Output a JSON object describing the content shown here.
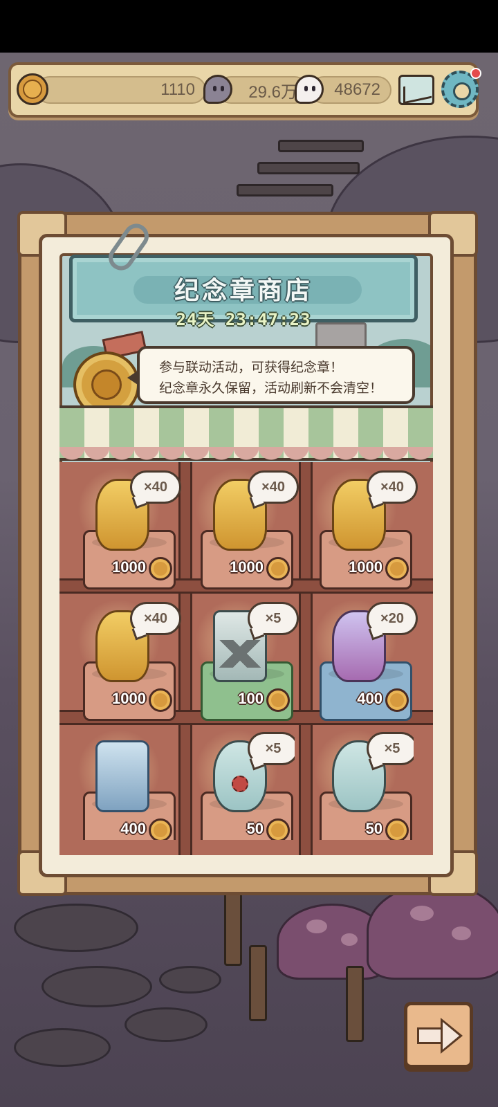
{
  "status_bar": {},
  "top_bar": {
    "coins": "1110",
    "gray_bubbles": "29.6万",
    "white_bubbles": "48672",
    "icons": [
      "coin-icon",
      "gray-bubble-icon",
      "white-bubble-icon",
      "mail-icon",
      "gear-icon"
    ],
    "settings_has_notification": true
  },
  "shop": {
    "title": "纪念章商店",
    "timer": "24天 23:47:23",
    "tip_line1": "参与联动活动，可获得纪念章！",
    "tip_line2": "纪念章永久保留，活动刷新不会清空！",
    "items": [
      {
        "quantity": "×40",
        "price": "1000",
        "figure": "golden-monkey-statue",
        "stand": "red"
      },
      {
        "quantity": "×40",
        "price": "1000",
        "figure": "golden-winged-creature-statue",
        "stand": "red"
      },
      {
        "quantity": "×40",
        "price": "1000",
        "figure": "golden-bird-statue",
        "stand": "red"
      },
      {
        "quantity": "×40",
        "price": "1000",
        "figure": "golden-girl-statue",
        "stand": "red"
      },
      {
        "quantity": "×5",
        "price": "100",
        "figure": "mountain-jar",
        "stand": "green"
      },
      {
        "quantity": "×20",
        "price": "400",
        "figure": "unicorn-lady",
        "stand": "blue"
      },
      {
        "quantity": "",
        "price": "400",
        "figure": "blue-robot-shrine",
        "stand": "red"
      },
      {
        "quantity": "×5",
        "price": "50",
        "figure": "germ-bottle",
        "stand": "red"
      },
      {
        "quantity": "×5",
        "price": "50",
        "figure": "vine-bottle",
        "stand": "red"
      }
    ],
    "currency_icon": "medal-coin-icon"
  },
  "navigation": {
    "next_icon": "arrow-right-icon"
  },
  "colors": {
    "panel_wood": "#c39a6c",
    "title_board": "#8ec3c3",
    "top_bar": "#e9d6a8",
    "notification": "#e54b4b"
  }
}
